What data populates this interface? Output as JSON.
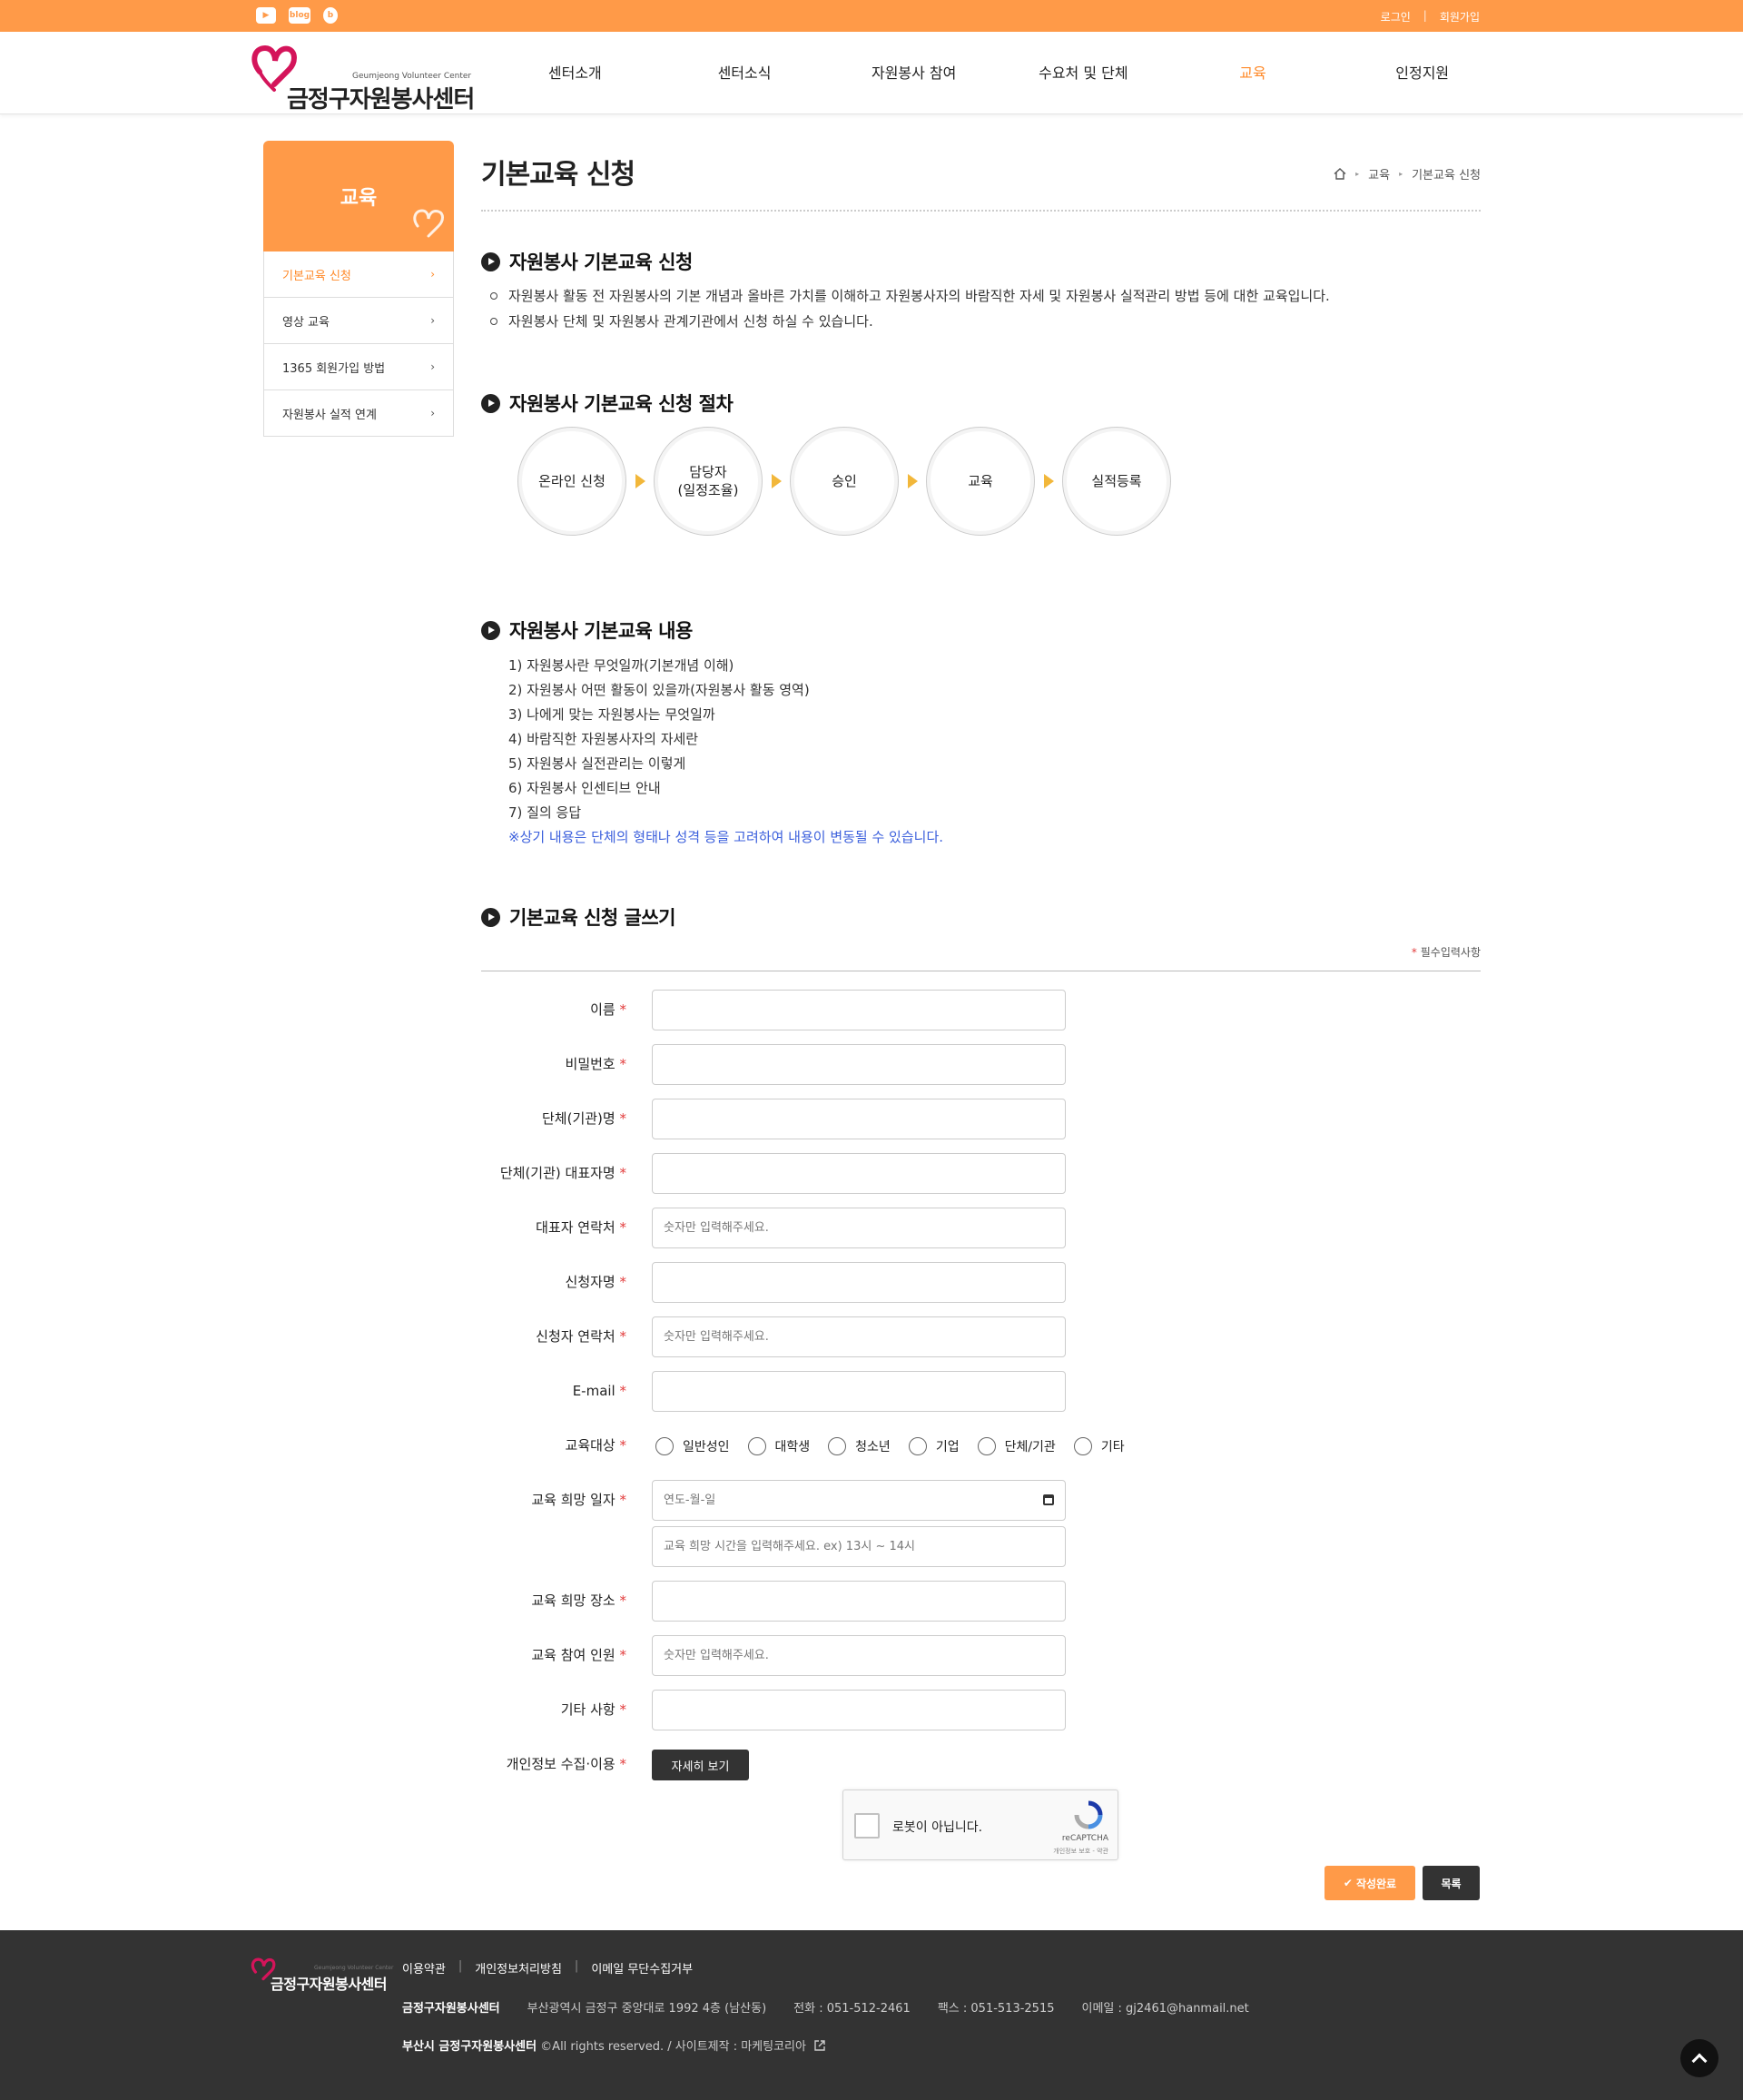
{
  "topbar": {
    "sns": [
      "youtube-icon",
      "blog-icon",
      "band-icon"
    ],
    "sns_labels": [
      "▶",
      "blog",
      "b"
    ],
    "login": "로그인",
    "separator": "|",
    "signup": "회원가입"
  },
  "header": {
    "logo_en": "Geumjeong Volunteer Center",
    "logo_ko": "금정구자원봉사센터",
    "menu": [
      "센터소개",
      "센터소식",
      "자원봉사 참여",
      "수요처 및 단체",
      "교육",
      "인정지원"
    ],
    "active_menu": "교육"
  },
  "sidebar": {
    "title": "교육",
    "items": [
      {
        "label": "기본교육 신청",
        "active": true
      },
      {
        "label": "영상 교육",
        "active": false
      },
      {
        "label": "1365 회원가입 방법",
        "active": false
      },
      {
        "label": "자원봉사 실적 연계",
        "active": false
      }
    ]
  },
  "content": {
    "title": "기본교육 신청",
    "breadcrumb": [
      "교육",
      "기본교육 신청"
    ],
    "sections": {
      "apply": "자원봉사 기본교육 신청",
      "procedure": "자원봉사 기본교육 신청 절차",
      "contents": "자원봉사 기본교육 내용",
      "form": "기본교육 신청 글쓰기"
    },
    "apply_bullets": [
      "자원봉사 활동 전 자원봉사의 기본 개념과 올바른 가치를 이해하고 자원봉사자의 바람직한 자세 및 자원봉사 실적관리 방법 등에 대한 교육입니다.",
      "자원봉사 단체 및 자원봉사 관계기관에서 신청 하실 수 있습니다."
    ],
    "steps": [
      "온라인 신청",
      "담당자\n(일정조율)",
      "승인",
      "교육",
      "실적등록"
    ],
    "education_items": [
      "1) 자원봉사란 무엇일까(기본개념 이해)",
      "2) 자원봉사 어떤 활동이 있을까(자원봉사 활동 영역)",
      "3) 나에게 맞는 자원봉사는 무엇일까",
      "4) 바람직한 자원봉사자의 자세란",
      "5) 자원봉사 실전관리는 이렇게",
      "6) 자원봉사 인센티브 안내",
      "7) 질의 응답"
    ],
    "education_note": "※상기 내용은 단체의 형태나 성격 등을 고려하여 내용이 변동될 수 있습니다."
  },
  "form": {
    "required_note": "필수입력사항",
    "required_mark": "*",
    "fields": {
      "name": {
        "label": "이름",
        "placeholder": ""
      },
      "password": {
        "label": "비밀번호",
        "placeholder": ""
      },
      "org_name": {
        "label": "단체(기관)명",
        "placeholder": ""
      },
      "org_rep": {
        "label": "단체(기관) 대표자명",
        "placeholder": ""
      },
      "rep_phone": {
        "label": "대표자 연락처",
        "placeholder": "숫자만 입력해주세요."
      },
      "applicant": {
        "label": "신청자명",
        "placeholder": ""
      },
      "applicant_phone": {
        "label": "신청자 연락처",
        "placeholder": "숫자만 입력해주세요."
      },
      "email": {
        "label": "E-mail",
        "placeholder": ""
      },
      "target": {
        "label": "교육대상",
        "options": [
          "일반성인",
          "대학생",
          "청소년",
          "기업",
          "단체/기관",
          "기타"
        ]
      },
      "date": {
        "label": "교육 희망 일자",
        "placeholder": "연도-월-일",
        "time_placeholder": "교육 희망 시간을 입력해주세요. ex) 13시 ~ 14시"
      },
      "place": {
        "label": "교육 희망 장소",
        "placeholder": ""
      },
      "count": {
        "label": "교육 참여 인원",
        "placeholder": "숫자만 입력해주세요."
      },
      "etc": {
        "label": "기타 사항",
        "placeholder": ""
      },
      "privacy": {
        "label": "개인정보 수집·이용",
        "button": "자세히 보기"
      }
    },
    "recaptcha": {
      "label": "로봇이 아닙니다.",
      "brand": "reCAPTCHA",
      "terms": "개인정보 보호 - 약관"
    },
    "submit": "작성완료",
    "submit_icon": "check-icon",
    "list": "목록"
  },
  "footer": {
    "logo_en": "Geumjeong Volunteer Center",
    "logo_ko": "금정구자원봉사센터",
    "links": [
      "이용약관",
      "개인정보처리방침",
      "이메일 무단수집거부"
    ],
    "separator": "|",
    "org": "금정구자원봉사센터",
    "address": "부산광역시 금정구 중앙대로 1992 4층 (남산동)",
    "phone": "전화 : 051-512-2461",
    "fax": "팩스 : 051-513-2515",
    "email": "이메일 : gj2461@hanmail.net",
    "copy_org": "부산시 금정구자원봉사센터",
    "copy_text": " ©All rights reserved. / 사이트제작 : 마케팅코리아"
  },
  "colors": {
    "accent": "#ff9a48",
    "accent_text": "#ff8a2a",
    "dark": "#333333",
    "note": "#3b5fdc",
    "arrow": "#f2b73a"
  }
}
